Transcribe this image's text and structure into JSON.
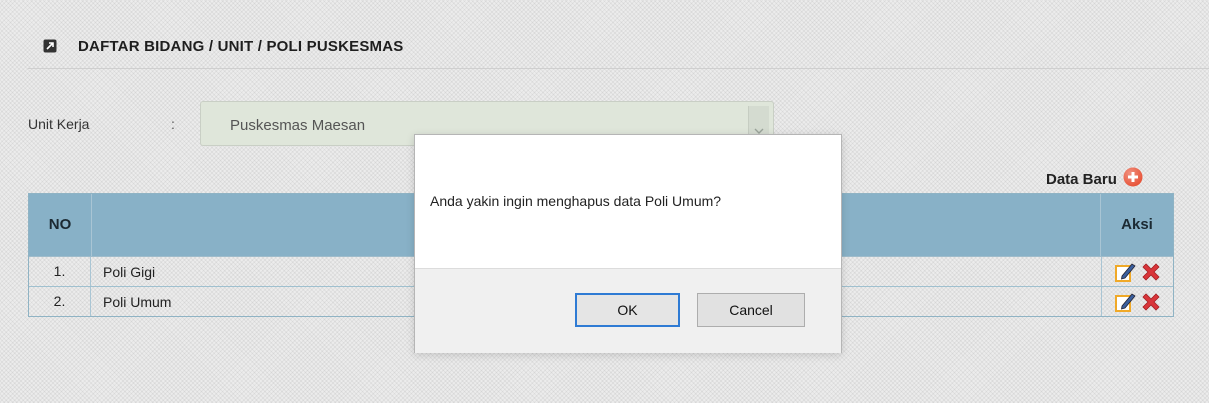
{
  "panel": {
    "title": "DAFTAR BIDANG / UNIT / POLI PUSKESMAS",
    "icon": "external-link-icon"
  },
  "filter": {
    "label": "Unit Kerja",
    "separator": ":",
    "selected": "Puskesmas Maesan"
  },
  "toolbar": {
    "add_label": "Data Baru",
    "add_icon": "plus-circle-icon"
  },
  "table": {
    "headers": [
      "NO",
      "",
      "Aksi"
    ],
    "rows": [
      {
        "no": "1.",
        "name": "Poli Gigi"
      },
      {
        "no": "2.",
        "name": "Poli Umum"
      }
    ],
    "actions": [
      "edit-icon",
      "delete-icon"
    ]
  },
  "dialog": {
    "message": "Anda yakin ingin menghapus data Poli Umum?",
    "ok_label": "OK",
    "cancel_label": "Cancel"
  },
  "colors": {
    "table_header": "#88b1c7",
    "add_icon": "#e8553a",
    "delete_icon": "#d9353a",
    "edit_icon": "#f0a928",
    "ok_border": "#2f7bd4"
  }
}
